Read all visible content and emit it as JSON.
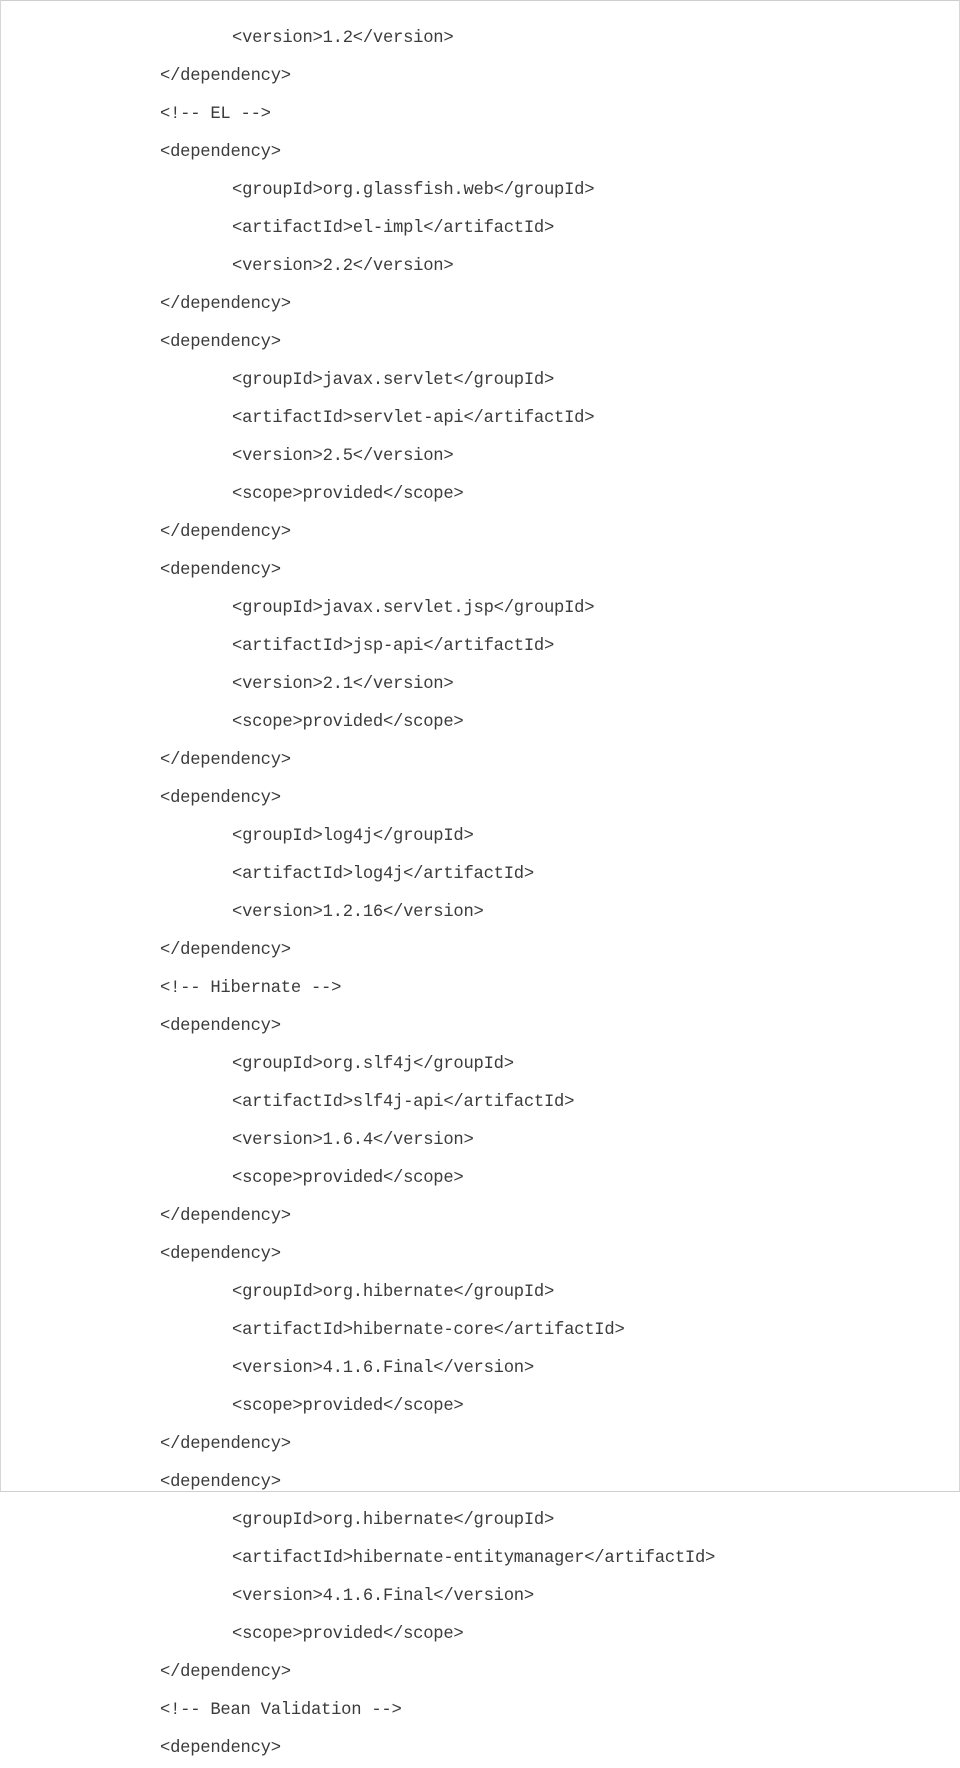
{
  "document": {
    "type": "code-listing",
    "language": "xml",
    "description": "Maven pom.xml dependency declarations",
    "indent_unit": "tab",
    "text_color": "#3b3b3b",
    "background_color": "#ffffff",
    "border_color": "#cfcfcf"
  },
  "code": {
    "lines": [
      {
        "indent": 1,
        "text": "<version>1.2</version>"
      },
      {
        "indent": 0,
        "text": "</dependency>"
      },
      {
        "indent": 0,
        "text": "<!-- EL -->"
      },
      {
        "indent": 0,
        "text": "<dependency>"
      },
      {
        "indent": 1,
        "text": "<groupId>org.glassfish.web</groupId>"
      },
      {
        "indent": 1,
        "text": "<artifactId>el-impl</artifactId>"
      },
      {
        "indent": 1,
        "text": "<version>2.2</version>"
      },
      {
        "indent": 0,
        "text": "</dependency>"
      },
      {
        "indent": 0,
        "text": "<dependency>"
      },
      {
        "indent": 1,
        "text": "<groupId>javax.servlet</groupId>"
      },
      {
        "indent": 1,
        "text": "<artifactId>servlet-api</artifactId>"
      },
      {
        "indent": 1,
        "text": "<version>2.5</version>"
      },
      {
        "indent": 1,
        "text": "<scope>provided</scope>"
      },
      {
        "indent": 0,
        "text": "</dependency>"
      },
      {
        "indent": 0,
        "text": "<dependency>"
      },
      {
        "indent": 1,
        "text": "<groupId>javax.servlet.jsp</groupId>"
      },
      {
        "indent": 1,
        "text": "<artifactId>jsp-api</artifactId>"
      },
      {
        "indent": 1,
        "text": "<version>2.1</version>"
      },
      {
        "indent": 1,
        "text": "<scope>provided</scope>"
      },
      {
        "indent": 0,
        "text": "</dependency>"
      },
      {
        "indent": 0,
        "text": "<dependency>"
      },
      {
        "indent": 1,
        "text": "<groupId>log4j</groupId>"
      },
      {
        "indent": 1,
        "text": "<artifactId>log4j</artifactId>"
      },
      {
        "indent": 1,
        "text": "<version>1.2.16</version>"
      },
      {
        "indent": 0,
        "text": "</dependency>"
      },
      {
        "indent": 0,
        "text": "<!-- Hibernate -->"
      },
      {
        "indent": 0,
        "text": "<dependency>"
      },
      {
        "indent": 1,
        "text": "<groupId>org.slf4j</groupId>"
      },
      {
        "indent": 1,
        "text": "<artifactId>slf4j-api</artifactId>"
      },
      {
        "indent": 1,
        "text": "<version>1.6.4</version>"
      },
      {
        "indent": 1,
        "text": "<scope>provided</scope>"
      },
      {
        "indent": 0,
        "text": "</dependency>"
      },
      {
        "indent": 0,
        "text": "<dependency>"
      },
      {
        "indent": 1,
        "text": "<groupId>org.hibernate</groupId>"
      },
      {
        "indent": 1,
        "text": "<artifactId>hibernate-core</artifactId>"
      },
      {
        "indent": 1,
        "text": "<version>4.1.6.Final</version>"
      },
      {
        "indent": 1,
        "text": "<scope>provided</scope>"
      },
      {
        "indent": 0,
        "text": "</dependency>"
      },
      {
        "indent": 0,
        "text": "<dependency>"
      },
      {
        "indent": 1,
        "text": "<groupId>org.hibernate</groupId>"
      },
      {
        "indent": 1,
        "text": "<artifactId>hibernate-entitymanager</artifactId>"
      },
      {
        "indent": 1,
        "text": "<version>4.1.6.Final</version>"
      },
      {
        "indent": 1,
        "text": "<scope>provided</scope>"
      },
      {
        "indent": 0,
        "text": "</dependency>"
      },
      {
        "indent": 0,
        "text": "<!-- Bean Validation -->"
      },
      {
        "indent": 0,
        "text": "<dependency>"
      }
    ]
  }
}
